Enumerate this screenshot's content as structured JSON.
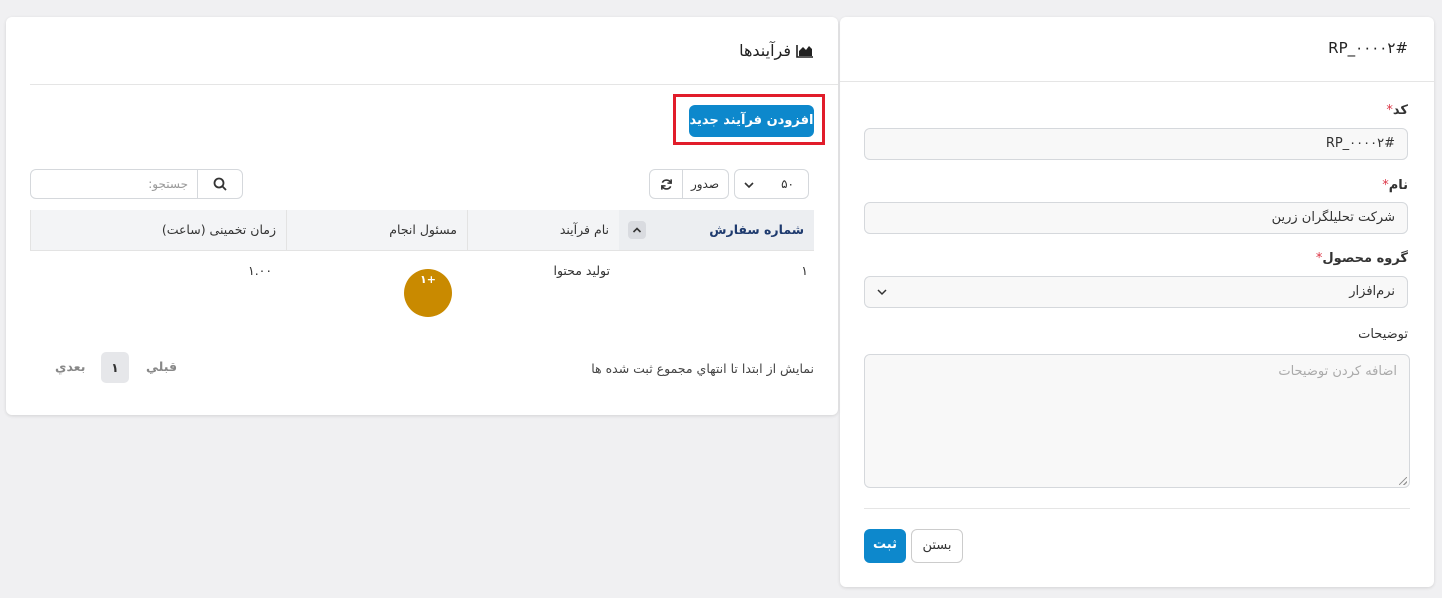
{
  "form": {
    "title": "RP_۰۰۰۰۲#",
    "code_label": "کد",
    "code_value": "RP_۰۰۰۰۲#",
    "name_label": "نام",
    "name_value": "شرکت تحلیلگران زرین",
    "group_label": "گروه محصول",
    "group_value": "نرم‌افزار",
    "desc_label": "توضیحات",
    "desc_placeholder": "اضافه کردن توضیحات",
    "required_mark": "*",
    "submit_label": "ثبت",
    "close_label": "بستن"
  },
  "processes": {
    "title": "فرآیندها",
    "add_button": "افزودن فرآیند جدید",
    "search_placeholder": "جستجو:",
    "page_size": "۵۰",
    "export_label": "صدور",
    "columns": [
      "شماره سفارش",
      "نام فرآیند",
      "مسئول انجام",
      "زمان تخمینی (ساعت)"
    ],
    "rows": [
      {
        "order": "۱",
        "name": "تولید محتوا",
        "responsible_badge": "۱+",
        "time": "۱.۰۰"
      }
    ],
    "footer_info": "نمايش از ابتدا تا انتهاي مجموع ثبت شده ها",
    "pagination": {
      "prev": "قبلي",
      "current": "۱",
      "next": "بعدي"
    }
  },
  "colors": {
    "primary": "#0d88cc",
    "highlight": "#e11d2a",
    "avatar": "#c98a00",
    "required": "#dc3545"
  }
}
